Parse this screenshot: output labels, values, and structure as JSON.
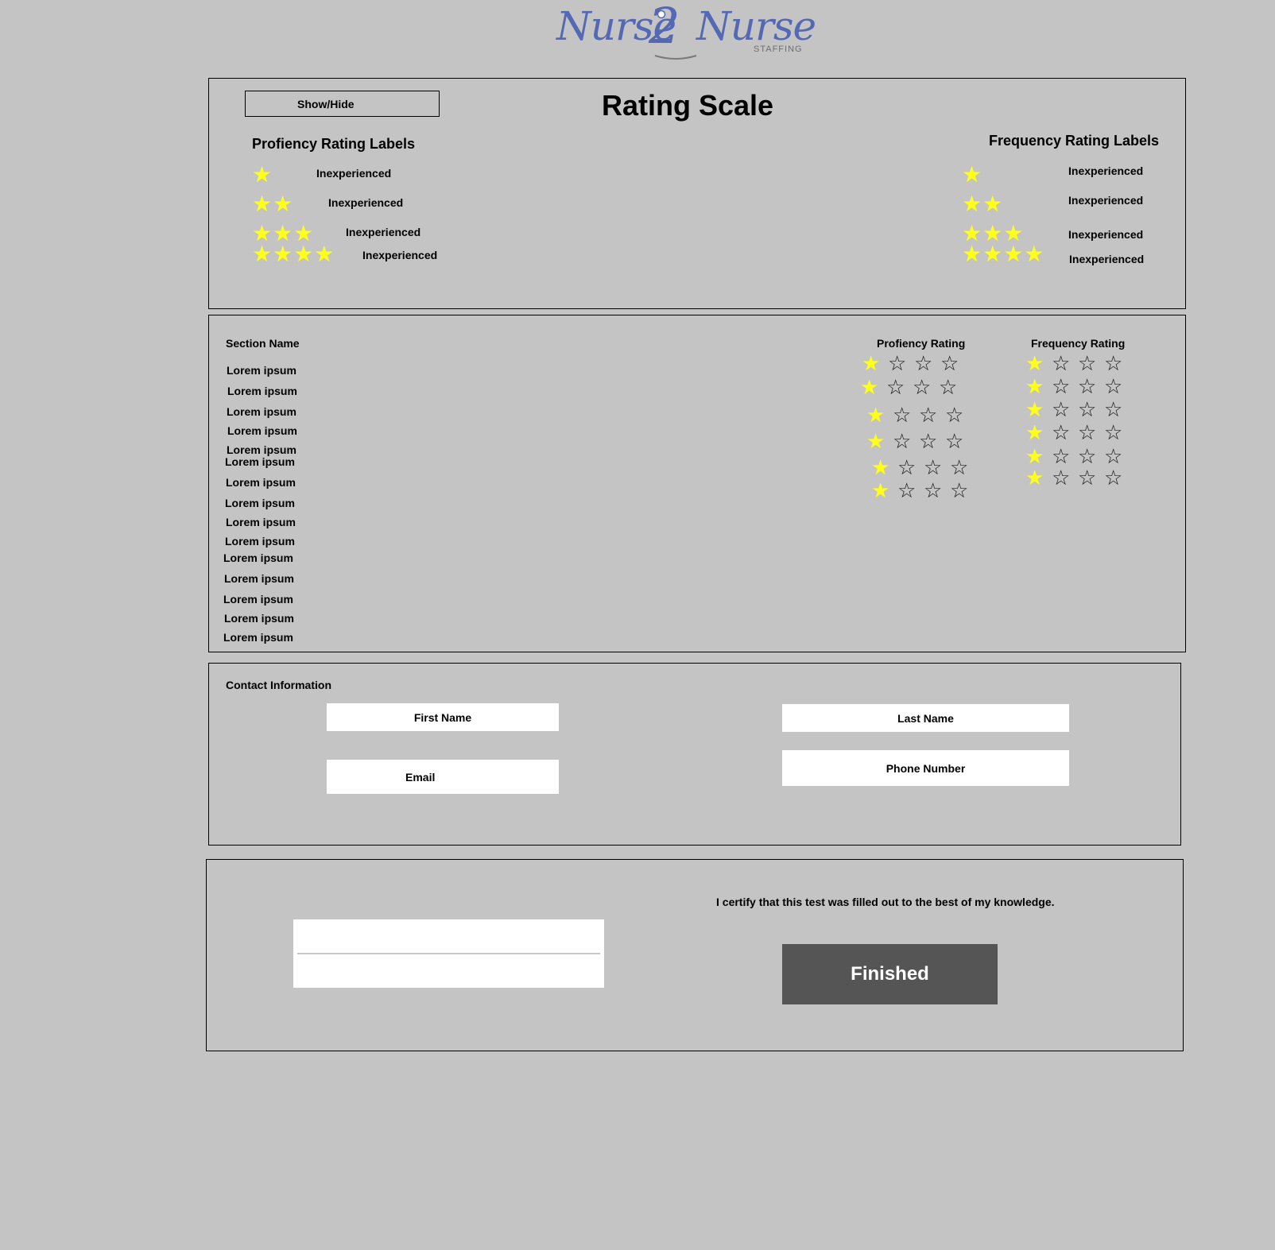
{
  "logo": {
    "word1": "Nurse",
    "digit": "2",
    "word2": "Nurse",
    "subtitle": "STAFFING",
    "color": "#5468b4"
  },
  "rating_panel": {
    "toggle_label": "Show/Hide",
    "title": "Rating Scale",
    "proficiency_heading": "Profiency Rating Labels",
    "frequency_heading": "Frequency Rating Labels",
    "proficiency_labels": [
      {
        "stars": 1,
        "label": "Inexperienced"
      },
      {
        "stars": 2,
        "label": "Inexperienced"
      },
      {
        "stars": 3,
        "label": "Inexperienced"
      },
      {
        "stars": 4,
        "label": "Inexperienced"
      }
    ],
    "frequency_labels": [
      {
        "stars": 1,
        "label": "Inexperienced"
      },
      {
        "stars": 2,
        "label": "Inexperienced"
      },
      {
        "stars": 3,
        "label": "Inexperienced"
      },
      {
        "stars": 4,
        "label": "Inexperienced"
      }
    ]
  },
  "sections_panel": {
    "section_header": "Section Name",
    "proficiency_header": "Profiency Rating",
    "frequency_header": "Frequency Rating",
    "items": [
      "Lorem ipsum",
      "Lorem ipsum",
      "Lorem ipsum",
      "Lorem ipsum",
      "Lorem ipsum",
      "Lorem ipsum",
      "Lorem ipsum",
      "Lorem ipsum",
      "Lorem ipsum",
      "Lorem ipsum",
      "Lorem ipsum",
      "Lorem ipsum",
      "Lorem ipsum",
      "Lorem ipsum",
      "Lorem ipsum"
    ],
    "proficiency_ratings": [
      1,
      1,
      1,
      1,
      1,
      1
    ],
    "frequency_ratings": [
      1,
      1,
      1,
      1,
      1,
      1
    ],
    "max_stars": 4
  },
  "contact_panel": {
    "heading": "Contact Information",
    "first_name": "First Name",
    "last_name": "Last Name",
    "email": "Email",
    "phone": "Phone Number"
  },
  "certify_panel": {
    "statement": "I certify that this test was filled out to the best of my knowledge.",
    "finish_label": "Finished"
  },
  "colors": {
    "background": "#c4c4c4",
    "star": "#ffff1a",
    "finish_button": "#555555"
  }
}
